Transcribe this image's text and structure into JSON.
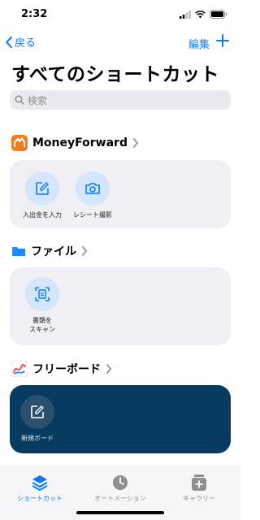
{
  "status": {
    "time": "2:32"
  },
  "nav": {
    "back_label": "戻る",
    "edit_label": "編集"
  },
  "title": "すべてのショートカット",
  "search": {
    "placeholder": "検索"
  },
  "sections": [
    {
      "name": "MoneyForward",
      "icon": "moneyforward-app-icon",
      "tiles": [
        {
          "label": "入出金を入力",
          "icon": "compose-icon"
        },
        {
          "label": "レシート撮影",
          "icon": "camera-icon"
        }
      ]
    },
    {
      "name": "ファイル",
      "icon": "folder-icon",
      "tiles": [
        {
          "label_line1": "書類を",
          "label_line2": "スキャン",
          "icon": "document-scan-icon"
        }
      ]
    },
    {
      "name": "フリーボード",
      "icon": "freeform-app-icon",
      "tiles": [
        {
          "label": "新規ボード",
          "icon": "compose-icon"
        }
      ]
    }
  ],
  "tabs": [
    {
      "label": "ショートカット",
      "icon": "layers-icon",
      "active": true
    },
    {
      "label": "オートメーション",
      "icon": "clock-check-icon",
      "active": false
    },
    {
      "label": "ギャラリー",
      "icon": "gallery-plus-icon",
      "active": false
    }
  ],
  "colors": {
    "accent": "#0a7aff",
    "card": "#efeff4",
    "dark_card": "#073b5f"
  }
}
